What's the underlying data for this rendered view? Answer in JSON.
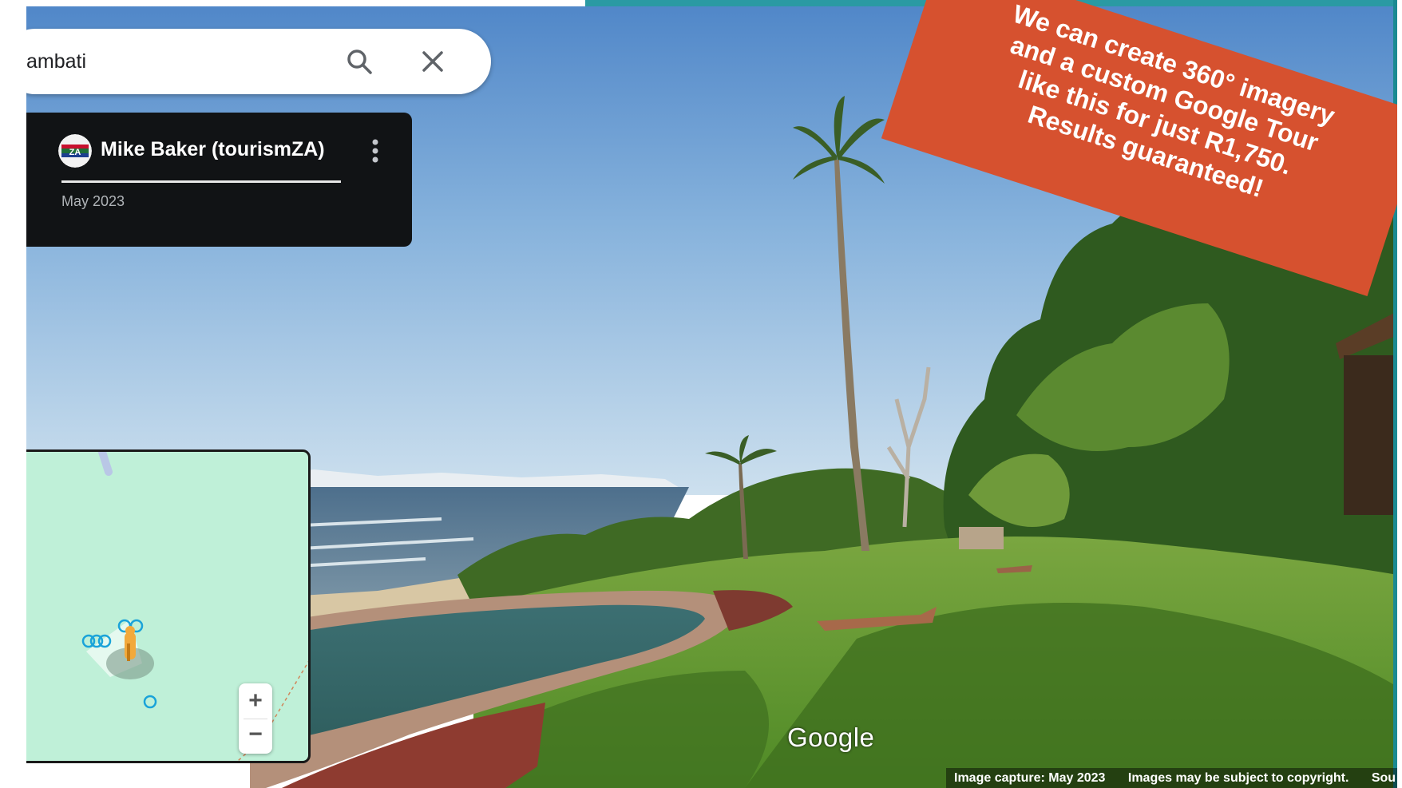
{
  "search": {
    "value": "ambati",
    "search_icon": "search-icon",
    "close_icon": "close-icon"
  },
  "info_card": {
    "contributor": "Mike Baker (tourismZA)",
    "avatar_badge": "ZA",
    "date": "May 2023",
    "menu_icon": "more-vert-icon"
  },
  "minimap": {
    "zoom_in_label": "+",
    "zoom_out_label": "−"
  },
  "branding": {
    "google_logo": "Google"
  },
  "footer": {
    "capture": "Image capture: May 2023",
    "copyright": "Images may be subject to copyright.",
    "source": "Sou"
  },
  "promo": {
    "line1": "We can create 360° imagery",
    "line2": "and a custom Google Tour",
    "line3": "like this for just R1,750.",
    "line4": "Results guaranteed!",
    "color": "#d6512f"
  },
  "colors": {
    "accent_bar": "#2a9aa3",
    "card_bg": "#111315",
    "minimap_bg": "#bff0d8"
  }
}
